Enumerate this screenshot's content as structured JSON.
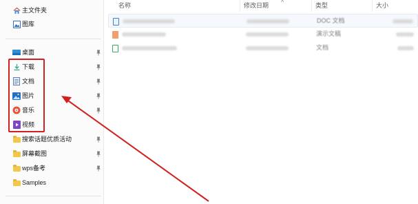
{
  "sidebar": {
    "items_top": [
      {
        "label": "主文件夹",
        "icon": "home-icon"
      },
      {
        "label": "图库",
        "icon": "gallery-icon"
      }
    ],
    "items_pinned": [
      {
        "label": "桌面",
        "icon": "desktop-icon"
      },
      {
        "label": "下载",
        "icon": "download-icon"
      },
      {
        "label": "文档",
        "icon": "documents-icon"
      },
      {
        "label": "图片",
        "icon": "pictures-icon"
      },
      {
        "label": "音乐",
        "icon": "music-icon"
      },
      {
        "label": "视频",
        "icon": "videos-icon"
      },
      {
        "label": "搜索话题优质活动",
        "icon": "folder-icon"
      },
      {
        "label": "屏幕截图",
        "icon": "folder-icon"
      },
      {
        "label": "wps备考",
        "icon": "folder-icon"
      },
      {
        "label": "Samples",
        "icon": "folder-icon"
      }
    ]
  },
  "columns": {
    "name": "名称",
    "modified": "修改日期",
    "type": "类型",
    "size": "大小"
  },
  "files": [
    {
      "type_text": "DOC 文档",
      "icon": "word-doc-icon",
      "selected": true
    },
    {
      "type_text": "演示文稿",
      "icon": "presentation-icon",
      "selected": false
    },
    {
      "type_text": "文档",
      "icon": "spreadsheet-icon",
      "selected": false
    }
  ],
  "colors": {
    "annotation": "#d21f1f",
    "folder": "#f1c84b",
    "selection": "#f5f8fc"
  }
}
